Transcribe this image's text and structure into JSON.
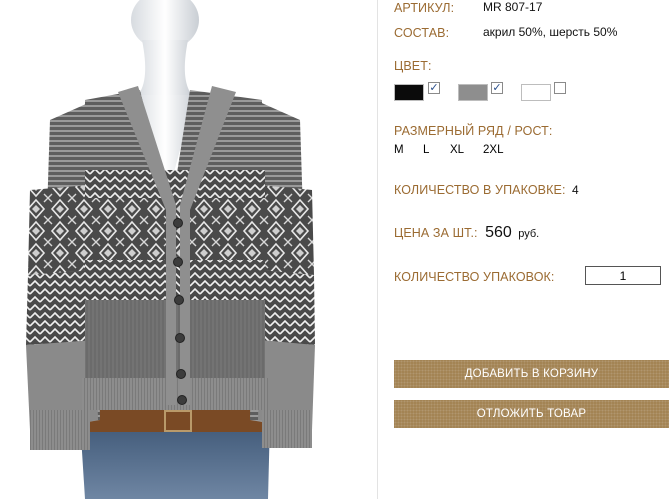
{
  "product": {
    "article_label": "АРТИКУЛ:",
    "article_value": "MR 807-17",
    "composition_label": "СОСТАВ:",
    "composition_value": "акрил 50%, шерсть 50%"
  },
  "colors": {
    "title": "ЦВЕТ:",
    "swatches": [
      {
        "name": "black",
        "hex": "#0b0b0b",
        "checked": true,
        "mark": "✓"
      },
      {
        "name": "grey",
        "hex": "#8e8e8e",
        "checked": true,
        "mark": "✓"
      },
      {
        "name": "white",
        "hex": "#ffffff",
        "checked": false,
        "mark": ""
      }
    ]
  },
  "sizes": {
    "title": "РАЗМЕРНЫЙ РЯД / РОСТ:",
    "items": [
      "M",
      "L",
      "XL",
      "2XL"
    ]
  },
  "pack": {
    "label": "КОЛИЧЕСТВО В УПАКОВКЕ:",
    "value": "4"
  },
  "price": {
    "label": "ЦЕНА ЗА ШТ.:",
    "value": "560",
    "currency": "руб."
  },
  "quantity": {
    "label": "КОЛИЧЕСТВО УПАКОВОК:",
    "value": "1"
  },
  "buttons": {
    "add_to_cart": "ДОБАВИТЬ В КОРЗИНУ",
    "postpone": "ОТЛОЖИТЬ ТОВАР"
  },
  "theme": {
    "accent": "#9b6b32",
    "button": "#a07f4e"
  }
}
